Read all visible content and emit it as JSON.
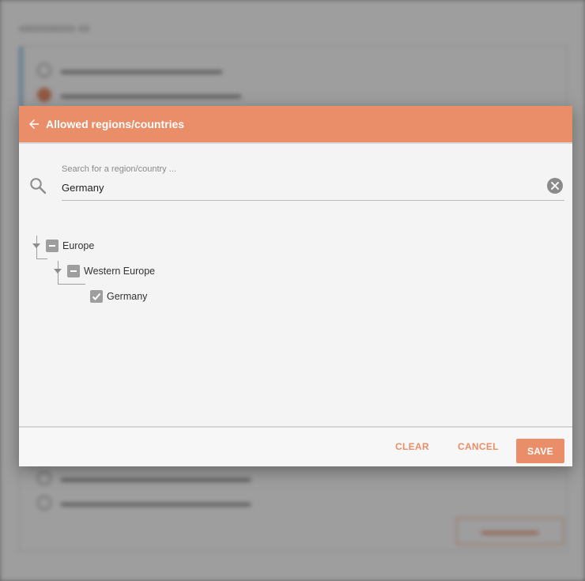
{
  "dialog": {
    "title": "Allowed regions/countries",
    "search": {
      "label": "Search for a region/country ...",
      "value": "Germany"
    },
    "tree": [
      {
        "label": "Europe",
        "state": "indeterminate",
        "expanded": true
      },
      {
        "label": "Western Europe",
        "state": "indeterminate",
        "expanded": true
      },
      {
        "label": "Germany",
        "state": "checked"
      }
    ],
    "footer": {
      "clear_label": "CLEAR",
      "cancel_label": "CANCEL",
      "save_label": "SAVE"
    }
  },
  "colors": {
    "accent": "#e98e68",
    "checkbox": "#9e9e9e",
    "dialog_bg": "#f4f4f4"
  }
}
